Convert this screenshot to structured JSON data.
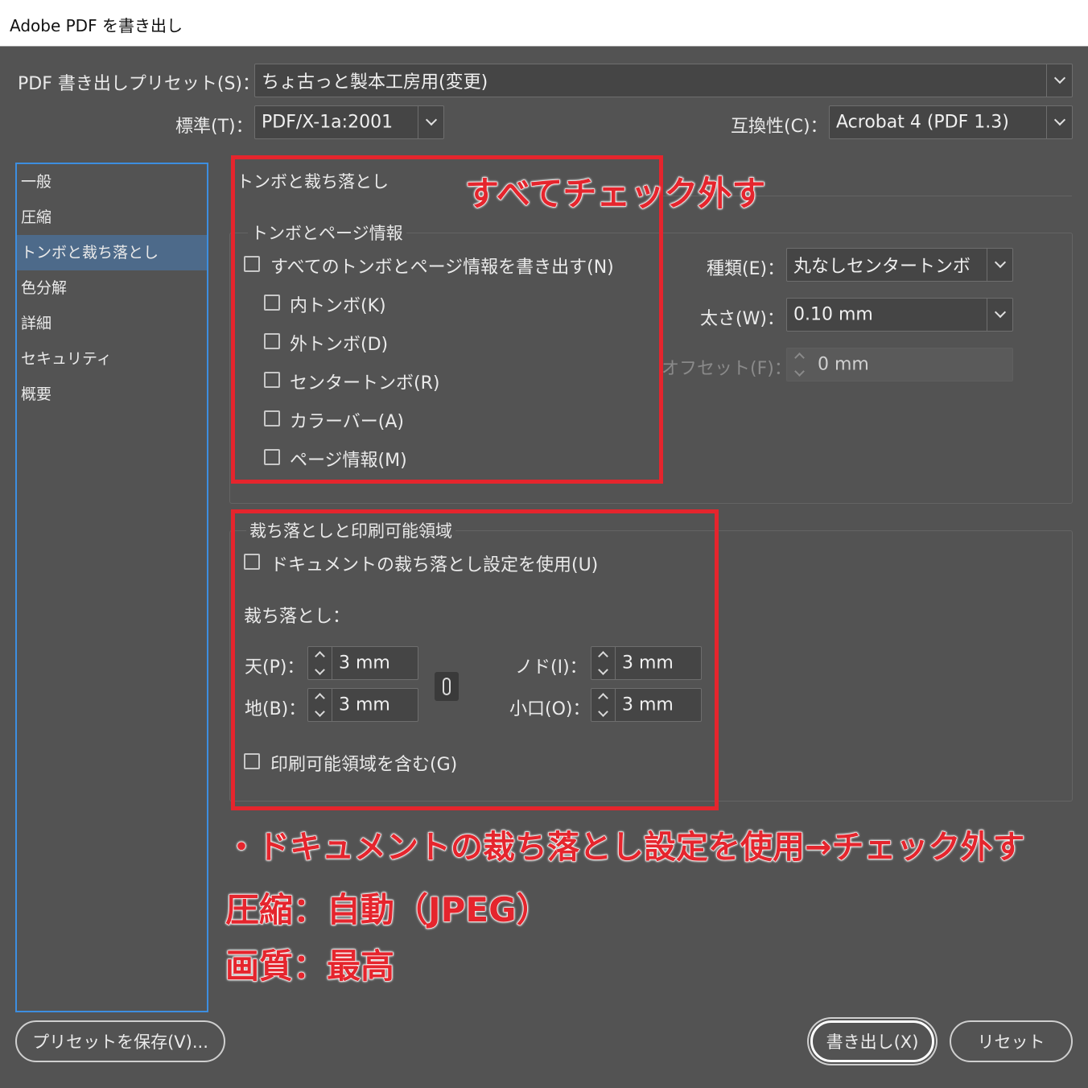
{
  "window": {
    "title": "Adobe PDF を書き出し"
  },
  "header": {
    "preset_label": "PDF 書き出しプリセット(S)：",
    "preset_value": "ちょ古っと製本工房用(変更)",
    "standard_label": "標準(T)：",
    "standard_value": "PDF/X-1a:2001",
    "compat_label": "互換性(C)：",
    "compat_value": "Acrobat 4 (PDF 1.3)"
  },
  "sidebar": {
    "items": [
      {
        "label": "一般"
      },
      {
        "label": "圧縮"
      },
      {
        "label": "トンボと裁ち落とし"
      },
      {
        "label": "色分解"
      },
      {
        "label": "詳細"
      },
      {
        "label": "セキュリティ"
      },
      {
        "label": "概要"
      }
    ],
    "active_index": 2
  },
  "section_title": "トンボと裁ち落とし",
  "marks": {
    "group_title": "トンボとページ情報",
    "all_marks": "すべてのトンボとページ情報を書き出す(N)",
    "crop": "内トンボ(K)",
    "bleed": "外トンボ(D)",
    "registration": "センタートンボ(R)",
    "color_bars": "カラーバー(A)",
    "page_info": "ページ情報(M)",
    "type_label": "種類(E)：",
    "type_value": "丸なしセンタートンボ",
    "weight_label": "太さ(W)：",
    "weight_value": "0.10 mm",
    "offset_label": "オフセット(F)：",
    "offset_value": "0 mm"
  },
  "bleed": {
    "group_title": "裁ち落としと印刷可能領域",
    "use_doc": "ドキュメントの裁ち落とし設定を使用(U)",
    "bleed_label": "裁ち落とし：",
    "top_label": "天(P)：",
    "top_value": "3 mm",
    "bottom_label": "地(B)：",
    "bottom_value": "3 mm",
    "inside_label": "ノド(I)：",
    "inside_value": "3 mm",
    "outside_label": "小口(O)：",
    "outside_value": "3 mm",
    "slug": "印刷可能領域を含む(G)"
  },
  "footer": {
    "save_preset": "プリセットを保存(V)...",
    "export": "書き出し(X)",
    "reset": "リセット"
  },
  "annotations": {
    "marks_note": "すべてチェック外す",
    "note1": "・ドキュメントの裁ち落とし設定を使用→チェック外す",
    "note2": "圧縮：自動（JPEG）",
    "note3": "画質：最高"
  },
  "colors": {
    "background": "#535353",
    "highlight": "#e5252d",
    "sidebar_border": "#3d8ee0",
    "active_item": "#4d6a8a"
  }
}
